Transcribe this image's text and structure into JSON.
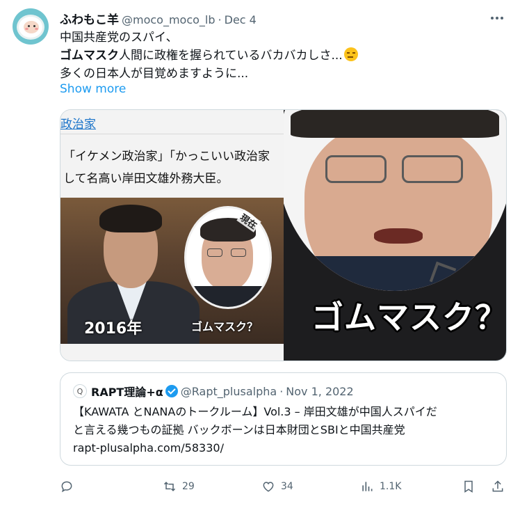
{
  "author": {
    "display_name": "ふわもこ羊",
    "handle": "@moco_moco_lb",
    "separator": "·",
    "date": "Dec 4"
  },
  "tweet": {
    "line1": "中国共産党のスパイ、",
    "line2_bold": "ゴムマスク",
    "line2_rest": "人間に政権を握られているバカバカしさ...",
    "line3": "多くの日本人が目覚めますように...",
    "show_more": "Show more",
    "emoji_icon": "expressionless-face-emoji"
  },
  "media": {
    "left": {
      "link": "政治家",
      "caption_line1": "「イケメン政治家」「かっこいい政治家",
      "caption_line2": "して名高い岸田文雄外務大臣。",
      "year_label": "2016年",
      "now_label": "現在",
      "small_caption": "ゴムマスク？"
    },
    "right": {
      "big_caption": "ゴムマスク？"
    }
  },
  "quote": {
    "name": "RAPT理論+α",
    "handle": "@Rapt_plusalpha",
    "separator": "·",
    "date": "Nov 1, 2022",
    "text_line1": "【KAWATA とNANAのトークルーム】Vol.3 – 岸田文雄が中国人スパイだ",
    "text_line2": "と言える幾つもの証拠 バックボーンは日本財団とSBIと中国共産党",
    "text_line3": "rapt-plusalpha.com/58330/",
    "avatar_glyph": "Q"
  },
  "actions": {
    "reply_count": "",
    "retweet_count": "29",
    "like_count": "34",
    "views_count": "1.1K"
  },
  "colors": {
    "accent": "#1d9bf0",
    "muted": "#536471",
    "text": "#0f1419",
    "border": "#cfd9de"
  }
}
